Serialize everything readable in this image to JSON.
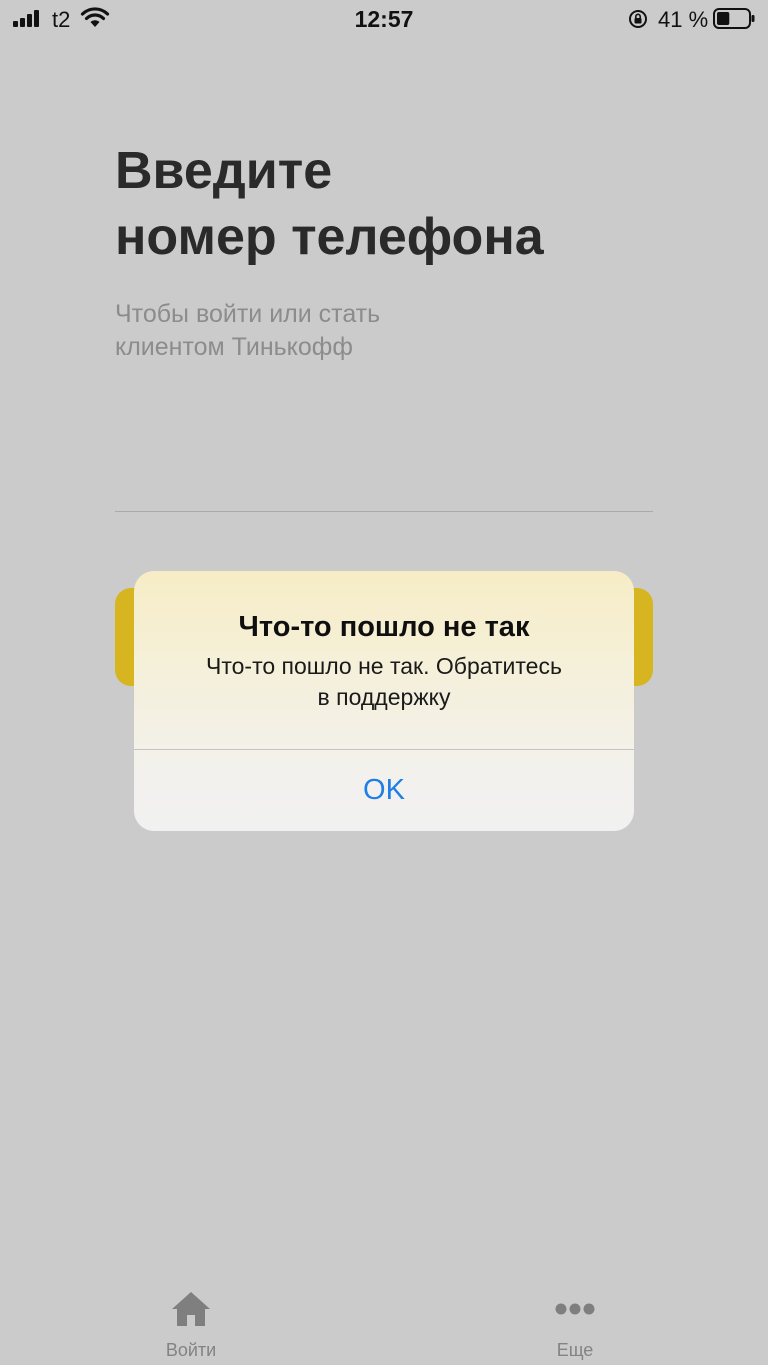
{
  "status_bar": {
    "carrier": "t2",
    "time": "12:57",
    "battery_percent": "41 %",
    "battery_level": 0.41
  },
  "main": {
    "title_line1": "Введите",
    "title_line2": "номер телефона",
    "subtitle_line1": "Чтобы войти или стать",
    "subtitle_line2": "клиентом Тинькофф",
    "phone_value": "",
    "accent_color": "#d6b521"
  },
  "alert": {
    "title": "Что-то пошло не так",
    "message_line1": "Что-то пошло не так. Обратитесь",
    "message_line2": "в поддержку",
    "ok_label": "OK",
    "ok_color": "#1f7fe6"
  },
  "tab_bar": {
    "items": [
      {
        "label": "Войти",
        "icon": "home-icon"
      },
      {
        "label": "Еще",
        "icon": "more-icon"
      }
    ]
  }
}
